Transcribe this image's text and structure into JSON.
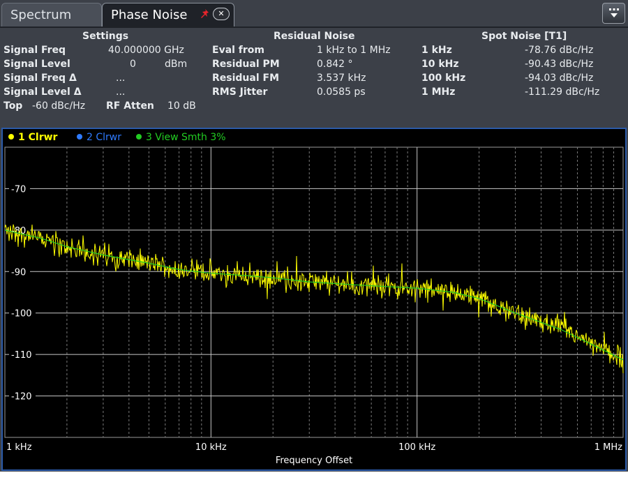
{
  "tabs": {
    "spectrum": "Spectrum",
    "phase_noise": "Phase Noise"
  },
  "settings": {
    "header": "Settings",
    "signal_freq_label": "Signal Freq",
    "signal_freq_value": "40.000000 GHz",
    "signal_level_label": "Signal Level",
    "signal_level_value": "0",
    "signal_level_unit": "dBm",
    "signal_freq_delta_label": "Signal Freq Δ",
    "signal_freq_delta_value": "...",
    "signal_level_delta_label": "Signal Level Δ",
    "signal_level_delta_value": "...",
    "top_label": "Top",
    "top_value": "-60 dBc/Hz",
    "rf_atten_label": "RF Atten",
    "rf_atten_value": "10 dB"
  },
  "residual": {
    "header": "Residual Noise",
    "rows": [
      {
        "label": "Eval from",
        "value": "1 kHz to 1 MHz"
      },
      {
        "label": "Residual PM",
        "value": "0.842 °"
      },
      {
        "label": "Residual FM",
        "value": "3.537 kHz"
      },
      {
        "label": "RMS Jitter",
        "value": "0.0585 ps"
      }
    ]
  },
  "spot": {
    "header": "Spot Noise [T1]",
    "rows": [
      {
        "offset": "1 kHz",
        "value": "-78.76 dBc/Hz"
      },
      {
        "offset": "10 kHz",
        "value": "-90.43 dBc/Hz"
      },
      {
        "offset": "100 kHz",
        "value": "-94.03 dBc/Hz"
      },
      {
        "offset": "1 MHz",
        "value": "-111.29 dBc/Hz"
      }
    ]
  },
  "legend": [
    {
      "label": "1 Clrwr",
      "color": "#ffff00"
    },
    {
      "label": "2 Clrwr",
      "color": "#2f7bff"
    },
    {
      "label": "3 View Smth 3%",
      "color": "#22cc22"
    }
  ],
  "chart_data": {
    "type": "line",
    "xscale": "log",
    "xlim": [
      1000,
      1000000
    ],
    "ylim": [
      -130,
      -60
    ],
    "xlabel": "Frequency Offset",
    "ylabel": "",
    "x_ticks": [
      "1 kHz",
      "10 kHz",
      "100 kHz",
      "1 MHz"
    ],
    "y_ticks": [
      "-70",
      "-80",
      "-90",
      "-100",
      "-110",
      "-120"
    ],
    "grid": true,
    "series": [
      {
        "name": "1 Clrwr",
        "color": "#ffff00",
        "x": [
          1000,
          1500,
          2000,
          3000,
          5000,
          7000,
          10000,
          15000,
          20000,
          30000,
          50000,
          70000,
          100000,
          150000,
          200000,
          300000,
          500000,
          700000,
          1000000
        ],
        "y": [
          -80,
          -82,
          -84,
          -86,
          -88,
          -89.5,
          -90.4,
          -91,
          -91.5,
          -92.5,
          -93.2,
          -93.6,
          -94,
          -95,
          -96.5,
          -100,
          -104,
          -107.5,
          -111.3
        ]
      },
      {
        "name": "3 View Smth 3%",
        "color": "#22cc22",
        "x": [
          1000,
          1500,
          2000,
          3000,
          5000,
          7000,
          10000,
          15000,
          20000,
          30000,
          50000,
          70000,
          100000,
          150000,
          200000,
          300000,
          500000,
          700000,
          1000000
        ],
        "y": [
          -80,
          -82,
          -84,
          -86,
          -88,
          -89.5,
          -90.4,
          -91,
          -91.5,
          -92.5,
          -93.2,
          -93.6,
          -94,
          -95,
          -96.5,
          -100,
          -104,
          -107.5,
          -111.3
        ]
      }
    ]
  }
}
